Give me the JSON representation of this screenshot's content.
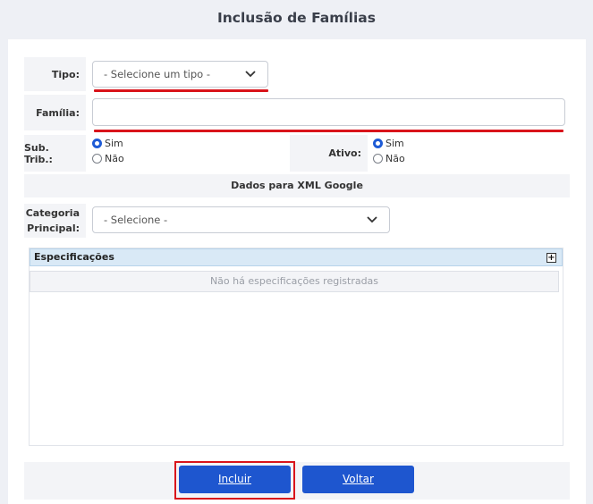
{
  "page": {
    "title": "Inclusão de Famílias"
  },
  "form": {
    "tipo": {
      "label": "Tipo:",
      "placeholder": "- Selecione um tipo -"
    },
    "familia": {
      "label": "Família:",
      "value": ""
    },
    "sub_trib": {
      "label": "Sub. Trib.:",
      "options": [
        "Sim",
        "Não"
      ],
      "selected": "Sim"
    },
    "ativo": {
      "label": "Ativo:",
      "options": [
        "Sim",
        "Não"
      ],
      "selected": "Sim"
    },
    "xml_section": {
      "title": "Dados para XML Google"
    },
    "categoria": {
      "label_line1": "Categoria",
      "label_line2": "Principal:",
      "placeholder": "- Selecione -"
    }
  },
  "specs": {
    "title": "Especificações",
    "add_icon": "+",
    "empty_message": "Não há especificações registradas"
  },
  "actions": {
    "include_label": "Incluir",
    "back_label": "Voltar"
  },
  "colors": {
    "accent": "#1e56cf",
    "highlight": "#d9141b",
    "header_blue": "#d9e9f6"
  }
}
